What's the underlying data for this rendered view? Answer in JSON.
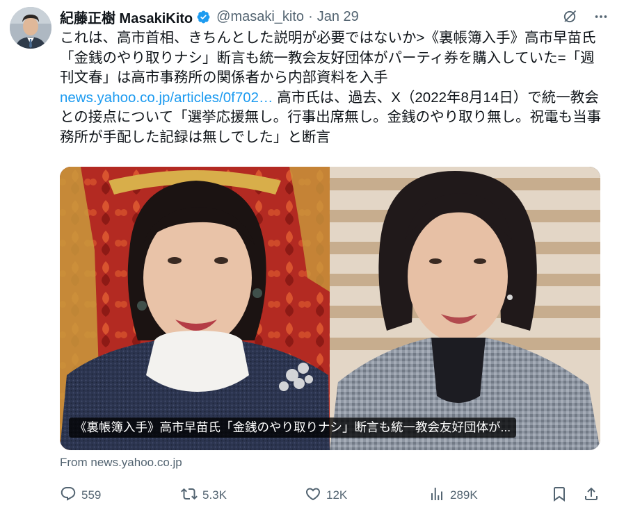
{
  "author": {
    "display_name": "紀藤正樹 MasakiKito",
    "handle": "@masaki_kito",
    "separator": "·",
    "date": "Jan 29",
    "verified": true
  },
  "tweet": {
    "text_before_link": "これは、高市首相、きちんとした説明が必要ではないか>《裏帳簿入手》高市早苗氏「金銭のやり取りナシ」断言も統一教会友好団体がパーティ券を購入していた=「週刊文春」は高市事務所の関係者から内部資料を入手\n",
    "link_text": "news.yahoo.co.jp/articles/0f702…",
    "text_after_link": " 高市氏は、過去、X（2022年8月14日）で統一教会との接点について「選挙応援無し。行事出席無し。金銭のやり取り無し。祝電も当事務所が手配した記録は無しでした」と断言"
  },
  "media": {
    "caption": "《裏帳簿入手》高市早苗氏「金銭のやり取りナシ」断言も統一教会友好団体が..."
  },
  "source": "From news.yahoo.co.jp",
  "actions": {
    "replies": "559",
    "reposts": "5.3K",
    "likes": "12K",
    "views": "289K"
  },
  "icons": {
    "verified": "verified-badge-icon",
    "grok": "grok-icon",
    "more": "more-icon",
    "reply": "reply-icon",
    "repost": "repost-icon",
    "like": "like-icon",
    "views": "views-icon",
    "bookmark": "bookmark-icon",
    "share": "share-icon"
  },
  "colors": {
    "text": "#0f1419",
    "secondary": "#536471",
    "link": "#1d9bf0",
    "verified": "#1d9bf0"
  }
}
